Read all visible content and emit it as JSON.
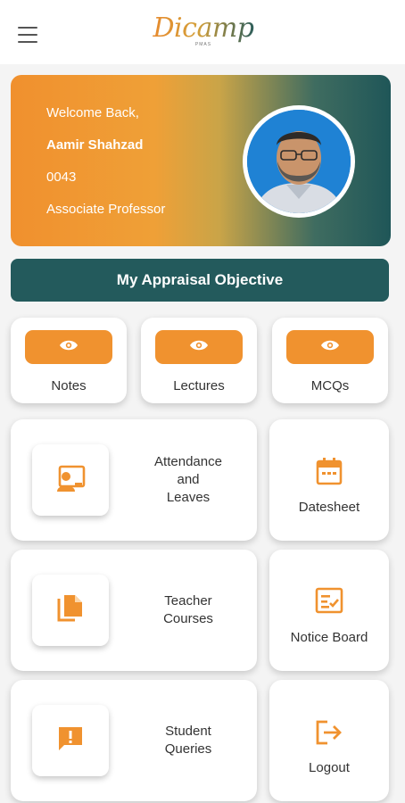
{
  "header": {
    "logo_text": "Dicamp",
    "logo_subtext": "PMAS"
  },
  "profile": {
    "greeting": "Welcome Back,",
    "name": "Aamir Shahzad",
    "id": "0043",
    "designation": "Associate Professor"
  },
  "appraisal": {
    "label": "My Appraisal Objective"
  },
  "quick_actions": [
    {
      "label": "Notes",
      "icon": "eye-icon"
    },
    {
      "label": "Lectures",
      "icon": "eye-icon"
    },
    {
      "label": "MCQs",
      "icon": "eye-icon"
    }
  ],
  "main_tiles": [
    {
      "label": "Attendance\nand\nLeaves",
      "icon": "person-board-icon"
    },
    {
      "label": "Teacher\nCourses",
      "icon": "documents-icon"
    },
    {
      "label": "Student\nQueries",
      "icon": "alert-message-icon"
    }
  ],
  "side_tiles": [
    {
      "label": "Datesheet",
      "icon": "calendar-icon"
    },
    {
      "label": "Notice Board",
      "icon": "checklist-icon"
    },
    {
      "label": "Logout",
      "icon": "logout-icon"
    }
  ],
  "colors": {
    "accent_orange": "#f0922f",
    "accent_teal": "#235a5c",
    "background": "#f4f4f4"
  }
}
